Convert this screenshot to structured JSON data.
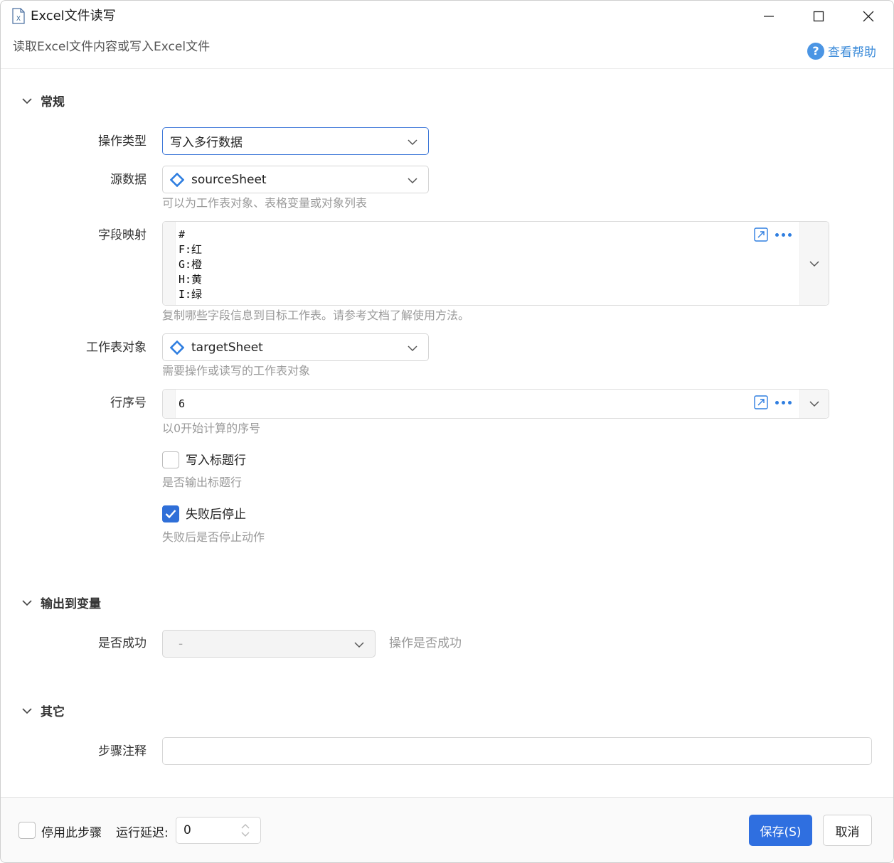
{
  "window": {
    "title": "Excel文件读写",
    "subtitle": "读取Excel文件内容或写入Excel文件",
    "help_label": "查看帮助"
  },
  "sections": {
    "general": "常规",
    "output": "输出到变量",
    "other": "其它"
  },
  "fields": {
    "operation_type": {
      "label": "操作类型",
      "value": "写入多行数据"
    },
    "source_data": {
      "label": "源数据",
      "value": "sourceSheet",
      "hint": "可以为工作表对象、表格变量或对象列表"
    },
    "field_mapping": {
      "label": "字段映射",
      "lines": [
        "#",
        "F:红",
        "G:橙",
        "H:黄",
        "I:绿"
      ],
      "hint": "复制哪些字段信息到目标工作表。请参考文档了解使用方法。"
    },
    "worksheet": {
      "label": "工作表对象",
      "value": "targetSheet",
      "hint": "需要操作或读写的工作表对象"
    },
    "row_index": {
      "label": "行序号",
      "value": "6",
      "hint": "以0开始计算的序号"
    },
    "write_header": {
      "label": "写入标题行",
      "checked": false,
      "hint": "是否输出标题行"
    },
    "stop_on_fail": {
      "label": "失败后停止",
      "checked": true,
      "hint": "失败后是否停止动作"
    },
    "success": {
      "label": "是否成功",
      "value": "-",
      "hint": "操作是否成功"
    },
    "step_note": {
      "label": "步骤注释",
      "value": ""
    }
  },
  "footer": {
    "disable_step": "停用此步骤",
    "delay_label": "运行延迟:",
    "delay_value": "0",
    "save": "保存(S)",
    "cancel": "取消"
  },
  "colors": {
    "accent": "#2f6fe0",
    "link": "#3c8bd9",
    "icon_blue": "#2f7ee0"
  },
  "icons": [
    "excel-file-icon",
    "minimize-icon",
    "maximize-icon",
    "close-icon",
    "help-circle-icon",
    "chevron-down-icon",
    "variable-diamond-icon",
    "expand-editor-icon",
    "more-options-icon",
    "checkmark-icon",
    "spinner-arrows-icon"
  ]
}
